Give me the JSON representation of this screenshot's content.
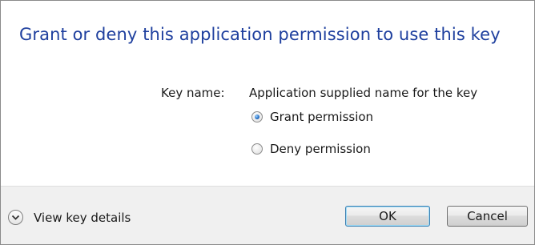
{
  "dialog": {
    "title": "Grant or deny this application permission to use this key",
    "key_label": "Key name:",
    "key_value": "Application supplied name for the key",
    "options": [
      {
        "label": "Grant permission",
        "selected": true
      },
      {
        "label": "Deny permission",
        "selected": false
      }
    ]
  },
  "footer": {
    "details_label": "View key details",
    "details_icon": "chevron-down-icon",
    "ok_label": "OK",
    "cancel_label": "Cancel"
  },
  "colors": {
    "title": "#1e3f9e",
    "footer_bg": "#f0f0f0",
    "default_button_border": "#3c7fb1"
  }
}
